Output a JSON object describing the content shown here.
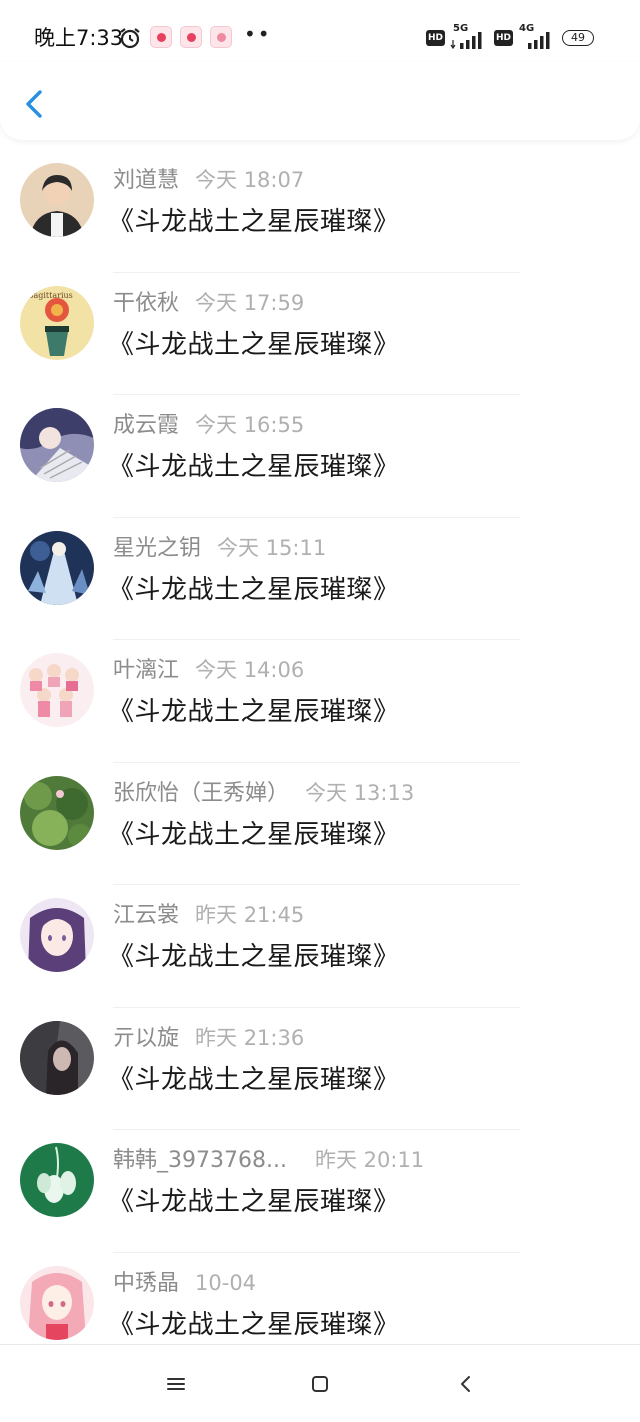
{
  "status_bar": {
    "time": "晚上7:33",
    "network_1": "5G",
    "network_2": "4G",
    "hd_label": "HD",
    "battery": "49",
    "more": "••"
  },
  "header": {
    "back_icon": "chevron-left-icon",
    "accent_color": "#2a8ee6"
  },
  "messages": [
    {
      "name": "刘道慧",
      "time": "今天 18:07",
      "text": "《斗龙战土之星辰璀璨》"
    },
    {
      "name": "干依秋",
      "time": "今天 17:59",
      "text": "《斗龙战土之星辰璀璨》"
    },
    {
      "name": "成云霞",
      "time": "今天 16:55",
      "text": "《斗龙战土之星辰璀璨》"
    },
    {
      "name": "星光之钥",
      "time": "今天 15:11",
      "text": "《斗龙战土之星辰璀璨》"
    },
    {
      "name": "叶漓江",
      "time": "今天 14:06",
      "text": "《斗龙战土之星辰璀璨》"
    },
    {
      "name": "张欣怡（王秀婵）",
      "time": "今天 13:13",
      "text": "《斗龙战土之星辰璀璨》"
    },
    {
      "name": "江云裳",
      "time": "昨天 21:45",
      "text": "《斗龙战土之星辰璀璨》"
    },
    {
      "name": "亓以旋",
      "time": "昨天 21:36",
      "text": "《斗龙战土之星辰璀璨》"
    },
    {
      "name": "韩韩_3973768...",
      "time": "昨天 20:11",
      "text": "《斗龙战土之星辰璀璨》"
    },
    {
      "name": "中琇晶",
      "time": "10-04",
      "text": "《斗龙战土之星辰璀璨》"
    }
  ],
  "nav_bar": {
    "menu_icon": "menu-icon",
    "home_icon": "square-home-icon",
    "back_icon": "back-triangle-icon"
  }
}
